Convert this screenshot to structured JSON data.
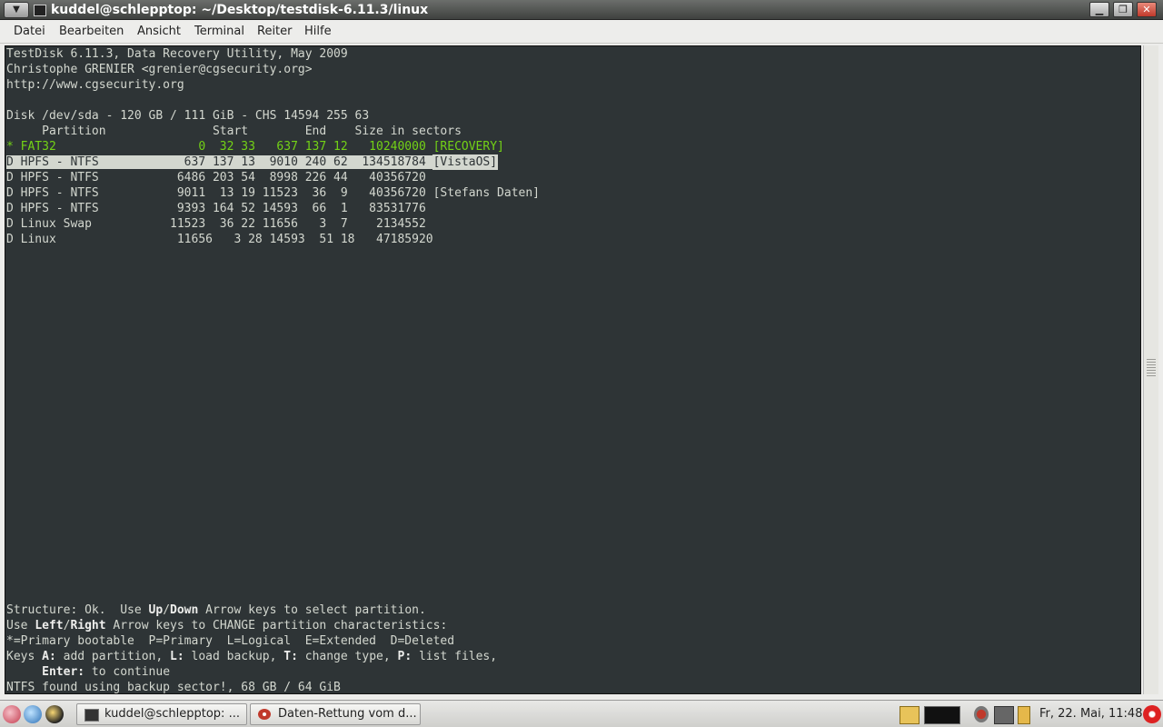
{
  "window": {
    "title": "kuddel@schlepptop: ~/Desktop/testdisk-6.11.3/linux",
    "controls": {
      "minimize": "▁",
      "maximize": "❐",
      "close": "✕"
    }
  },
  "menubar": {
    "items": [
      "Datei",
      "Bearbeiten",
      "Ansicht",
      "Terminal",
      "Reiter",
      "Hilfe"
    ]
  },
  "terminal": {
    "header": [
      "TestDisk 6.11.3, Data Recovery Utility, May 2009",
      "Christophe GRENIER <grenier@cgsecurity.org>",
      "http://www.cgsecurity.org"
    ],
    "disk_line": "Disk /dev/sda - 120 GB / 111 GiB - CHS 14594 255 63",
    "column_header": "     Partition               Start        End    Size in sectors",
    "rows": [
      {
        "text": "* FAT32                    0  32 33   637 137 12   10240000 [RECOVERY]",
        "style": "green"
      },
      {
        "text": "D HPFS - NTFS            637 137 13  9010 240 62  134518784 ",
        "label": "[VistaOS]",
        "style": "selected"
      },
      {
        "text": "D HPFS - NTFS           6486 203 54  8998 226 44   40356720",
        "style": "normal"
      },
      {
        "text": "D HPFS - NTFS           9011  13 19 11523  36  9   40356720 [Stefans Daten]",
        "style": "normal"
      },
      {
        "text": "D HPFS - NTFS           9393 164 52 14593  66  1   83531776",
        "style": "normal"
      },
      {
        "text": "D Linux Swap           11523  36 22 11656   3  7    2134552",
        "style": "normal"
      },
      {
        "text": "D Linux                 11656   3 28 14593  51 18   47185920",
        "style": "normal"
      }
    ],
    "footer": {
      "l1_a": "Structure: Ok.  Use ",
      "l1_up": "Up",
      "l1_slash": "/",
      "l1_down": "Down",
      "l1_b": " Arrow keys to select partition.",
      "l2_a": "Use ",
      "l2_left": "Left",
      "l2_slash": "/",
      "l2_right": "Right",
      "l2_b": " Arrow keys to CHANGE partition characteristics:",
      "l3": "*=Primary bootable  P=Primary  L=Logical  E=Extended  D=Deleted",
      "l4_a": "Keys ",
      "l4_ka": "A:",
      "l4_b": " add partition, ",
      "l4_kl": "L:",
      "l4_c": " load backup, ",
      "l4_kt": "T:",
      "l4_d": " change type, ",
      "l4_kp": "P:",
      "l4_e": " list files,",
      "l5_a": "     ",
      "l5_enter": "Enter:",
      "l5_b": " to continue",
      "l6": "NTFS found using backup sector!, 68 GB / 64 GiB"
    }
  },
  "taskbar": {
    "tasks": [
      {
        "label": "kuddel@schlepptop: ..."
      },
      {
        "label": "Daten-Rettung vom d..."
      }
    ],
    "clock": "Fr, 22. Mai, 11:48"
  },
  "colors": {
    "terminal_bg": "#2e3436",
    "terminal_fg": "#d3d7cf",
    "highlight_green": "#73d216",
    "selection_bg": "#d3d7cf"
  }
}
